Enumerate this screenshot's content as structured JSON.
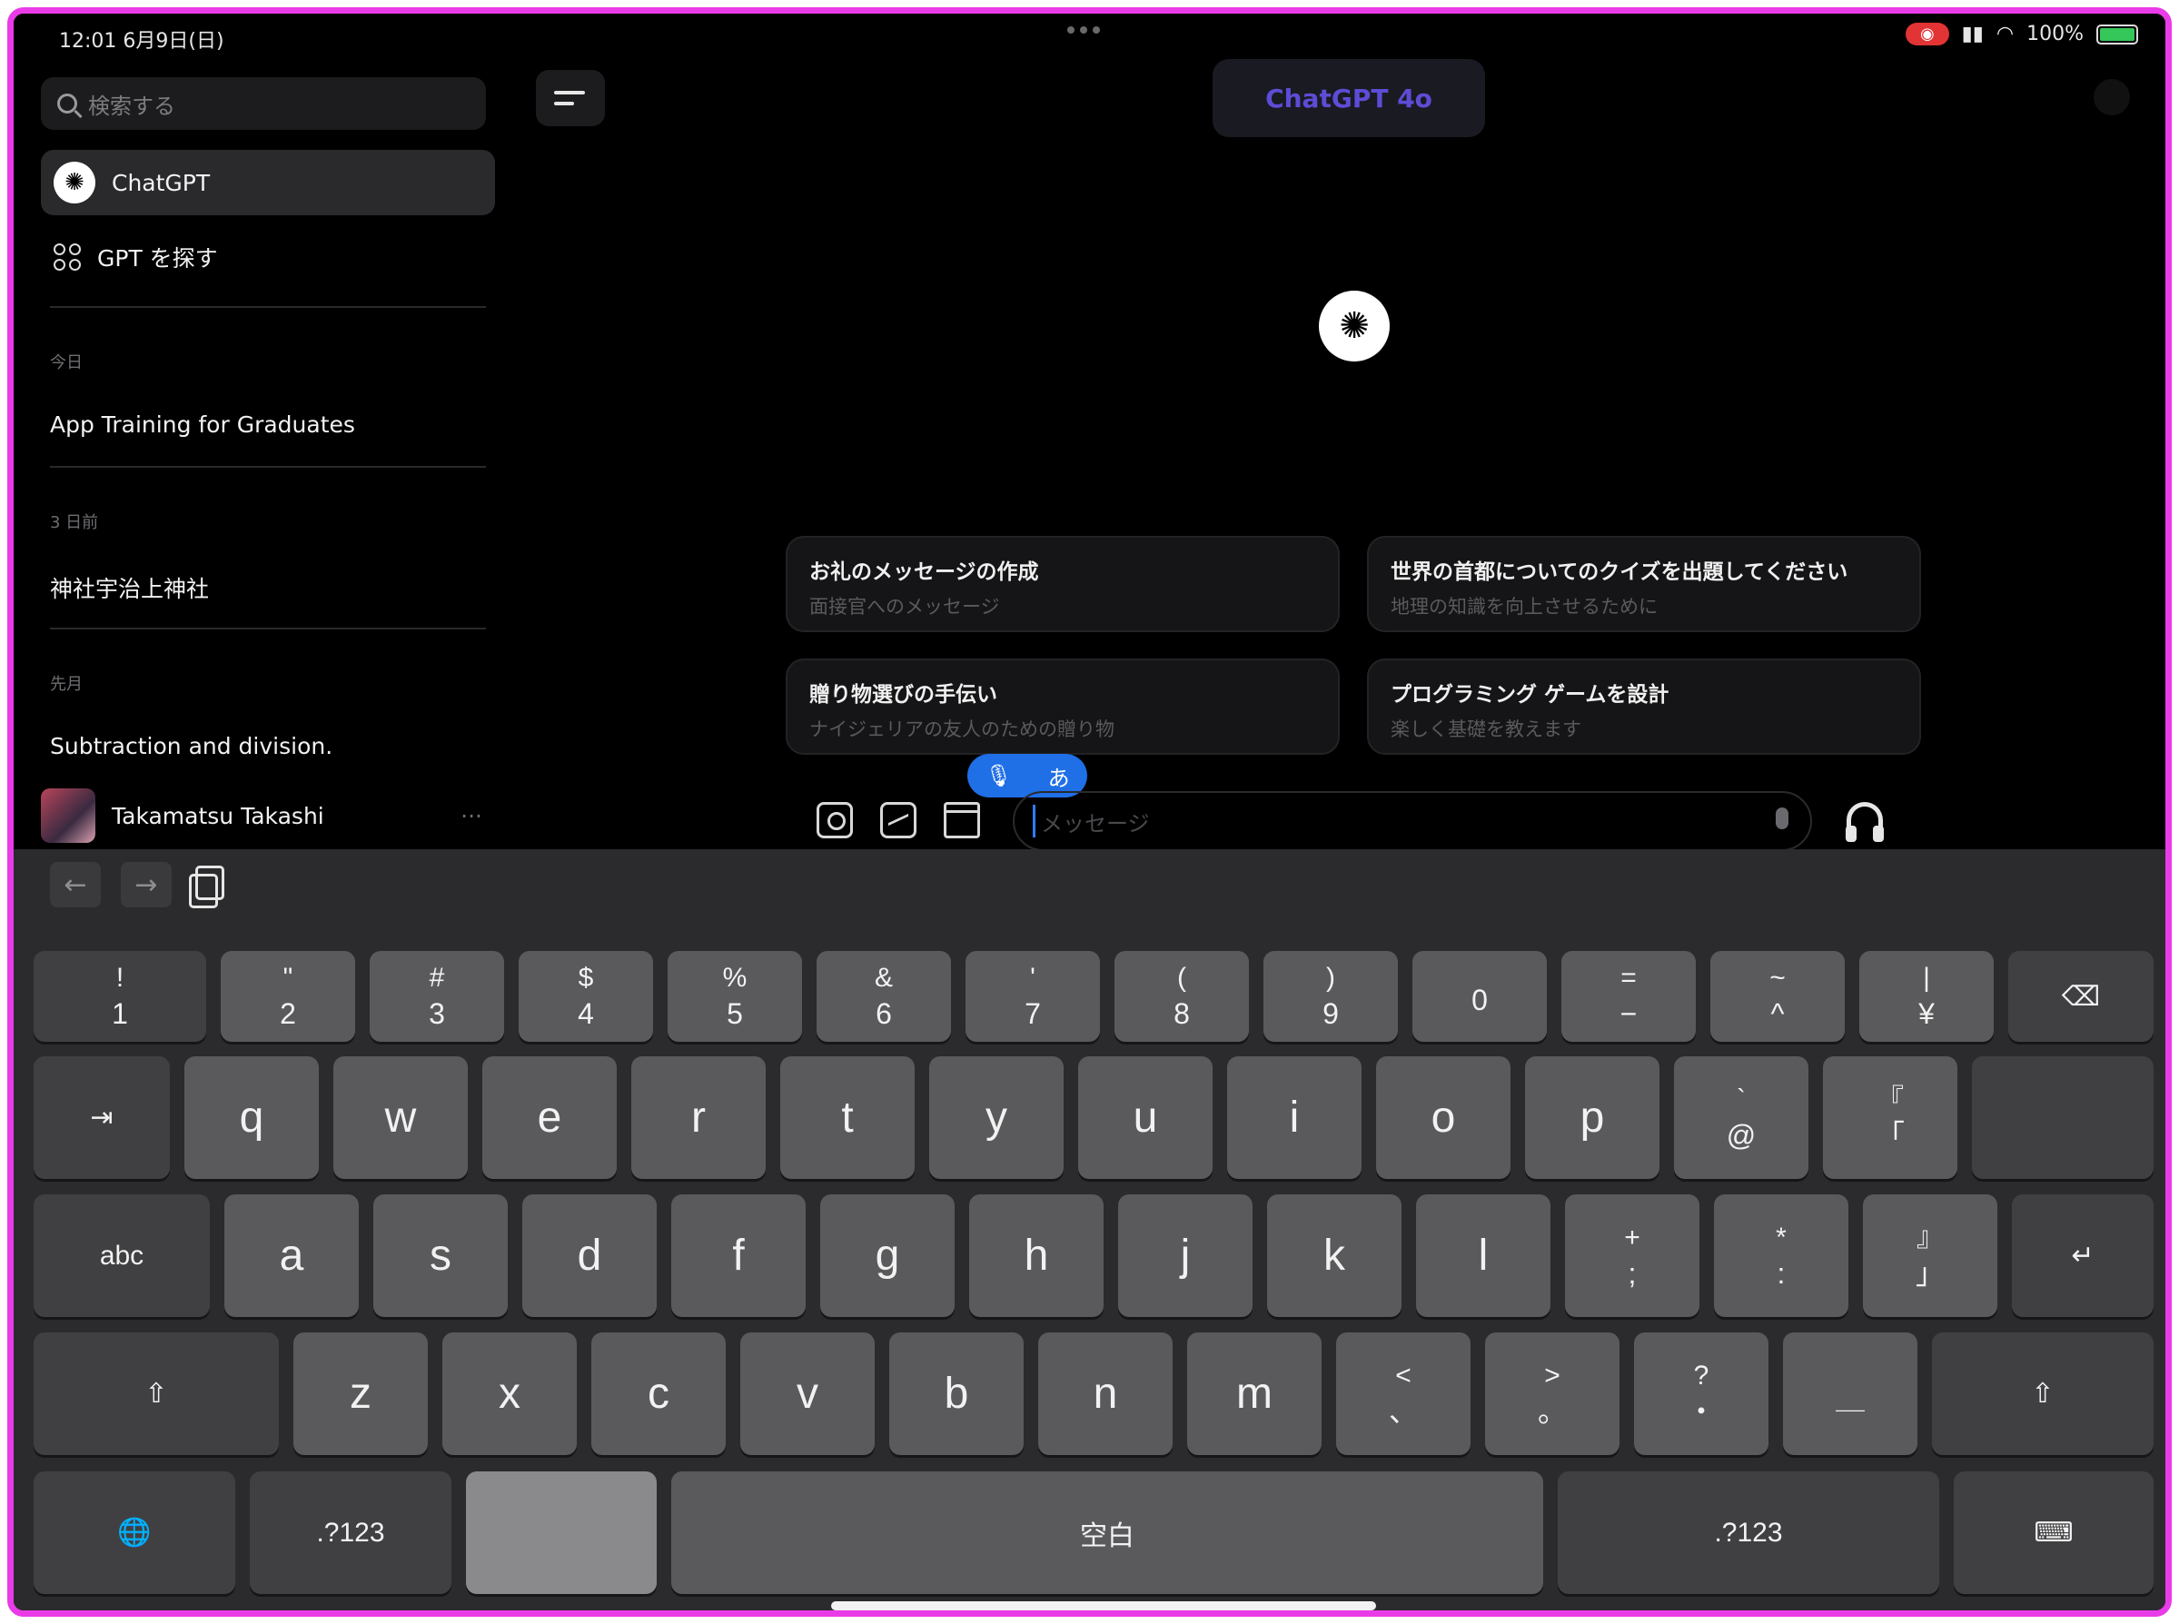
{
  "status": {
    "time": "12:01 6月9日(日)",
    "right": "100%",
    "signal_icon": "signal-icon",
    "wifi_icon": "wifi-icon"
  },
  "sidebar": {
    "search_placeholder": "検索する",
    "items": [
      {
        "label": "ChatGPT",
        "icon": "chatgpt-logo-icon"
      },
      {
        "label": "GPT を探す",
        "icon": "grid-icon"
      }
    ],
    "sections": [
      {
        "label": "今日",
        "chats": [
          "App Training for Graduates"
        ]
      },
      {
        "label": "3 日前",
        "chats": [
          "神社宇治上神社"
        ]
      },
      {
        "label": "先月",
        "chats": [
          "Subtraction and division."
        ]
      }
    ],
    "user": {
      "name": "Takamatsu Takashi",
      "more": "···"
    }
  },
  "main": {
    "model_label": "ChatGPT 4o",
    "suggestions": [
      {
        "title": "お礼のメッセージの作成",
        "subtitle": "面接官へのメッセージ"
      },
      {
        "title": "世界の首都についてのクイズを出題してください",
        "subtitle": "地理の知識を向上させるために"
      },
      {
        "title": "贈り物選びの手伝い",
        "subtitle": "ナイジェリアの友人のための贈り物"
      },
      {
        "title": "プログラミング ゲームを設計",
        "subtitle": "楽しく基礎を教えます"
      }
    ],
    "ime": {
      "mic": "🎙",
      "kana": "あ"
    },
    "composer": {
      "placeholder": "メッセージ"
    }
  },
  "keyboard": {
    "toolbar": {
      "undo": "←",
      "redo": "→"
    },
    "row1": [
      {
        "top": "!",
        "bot": "1"
      },
      {
        "top": "\"",
        "bot": "2"
      },
      {
        "top": "#",
        "bot": "3"
      },
      {
        "top": "$",
        "bot": "4"
      },
      {
        "top": "%",
        "bot": "5"
      },
      {
        "top": "&",
        "bot": "6"
      },
      {
        "top": "'",
        "bot": "7"
      },
      {
        "top": "(",
        "bot": "8"
      },
      {
        "top": ")",
        "bot": "9"
      },
      {
        "top": "",
        "bot": "0"
      },
      {
        "top": "=",
        "bot": "−"
      },
      {
        "top": "~",
        "bot": "^"
      },
      {
        "top": "|",
        "bot": "¥"
      }
    ],
    "row2": [
      "q",
      "w",
      "e",
      "r",
      "t",
      "y",
      "u",
      "i",
      "o",
      "p"
    ],
    "row2_extra": [
      {
        "top": "`",
        "bot": "@"
      },
      {
        "top": "『",
        "bot": "「"
      }
    ],
    "row3": [
      "a",
      "s",
      "d",
      "f",
      "g",
      "h",
      "j",
      "k",
      "l"
    ],
    "row3_extra": [
      {
        "top": "+",
        "bot": ";"
      },
      {
        "top": "*",
        "bot": ":"
      },
      {
        "top": "』",
        "bot": "」"
      }
    ],
    "row4": [
      "z",
      "x",
      "c",
      "v",
      "b",
      "n",
      "m"
    ],
    "row4_extra": [
      {
        "top": "<",
        "bot": "、"
      },
      {
        "top": ">",
        "bot": "。"
      },
      {
        "top": "?",
        "bot": "・"
      },
      {
        "top": "",
        "bot": "＿"
      }
    ],
    "abc": "abc",
    "num_left": ".?123",
    "num_right": ".?123",
    "space": "空白"
  }
}
